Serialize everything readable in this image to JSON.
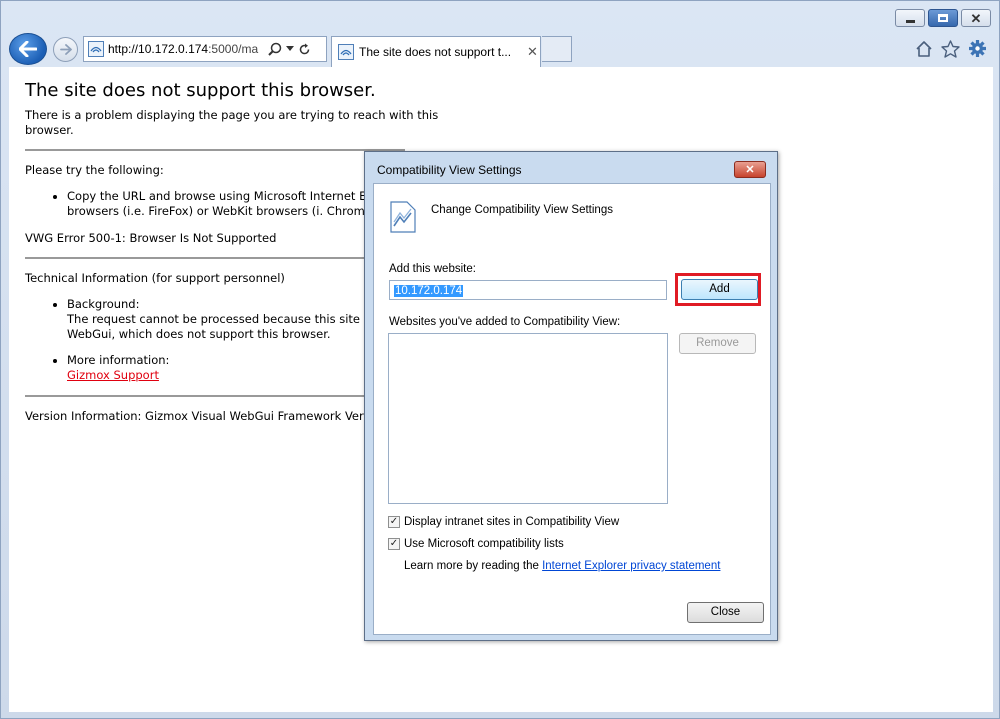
{
  "browser": {
    "address_host": "http://10.172.0.174",
    "address_rest": ":5000/ma",
    "tab_title": "The site does not support t...",
    "tab_close": "✕",
    "caption": {
      "min": "",
      "max": "",
      "close": "✕"
    },
    "icons": [
      "back-arrow-icon",
      "forward-arrow-icon",
      "site-favicon-icon",
      "search-icon",
      "refresh-icon",
      "home-icon",
      "star-icon",
      "gear-icon"
    ]
  },
  "page": {
    "heading": "The site does not support this browser.",
    "intro": "There is a problem displaying the page you are trying to reach with this browser.",
    "try_label": "Please try the following:",
    "try_item": "Copy the URL and browse using Microsoft Internet Ex Mozilla browsers (i.e. FireFox) or WebKit browsers (i. Chrome).",
    "error": "VWG Error 500-1: Browser Is Not Supported",
    "tech_label": "Technical Information (for support personnel)",
    "background_label": "Background:",
    "background_text": "The request cannot be processed because this site is Visual WebGui, which does not support this browser.",
    "more_label": "More information:",
    "more_link": "Gizmox Support",
    "version": "Version Information: Gizmox Visual WebGui Framework Vers Release c"
  },
  "dialog": {
    "title": "Compatibility View Settings",
    "close_glyph": "✕",
    "header": "Change Compatibility View Settings",
    "add_label": "Add this website:",
    "add_value": "10.172.0.174",
    "add_button": "Add",
    "list_label": "Websites you've added to Compatibility View:",
    "remove_button": "Remove",
    "check_intranet": "Display intranet sites in Compatibility View",
    "check_ms_lists": "Use Microsoft compatibility lists",
    "learn_prefix": "Learn more by reading the ",
    "learn_link": "Internet Explorer privacy statement",
    "close_button": "Close",
    "intranet_checked": true,
    "ms_lists_checked": true
  },
  "colors": {
    "highlight": "#e01b24",
    "link_red": "#e0000f",
    "link_blue": "#0046d5",
    "selection": "#3399ff"
  }
}
